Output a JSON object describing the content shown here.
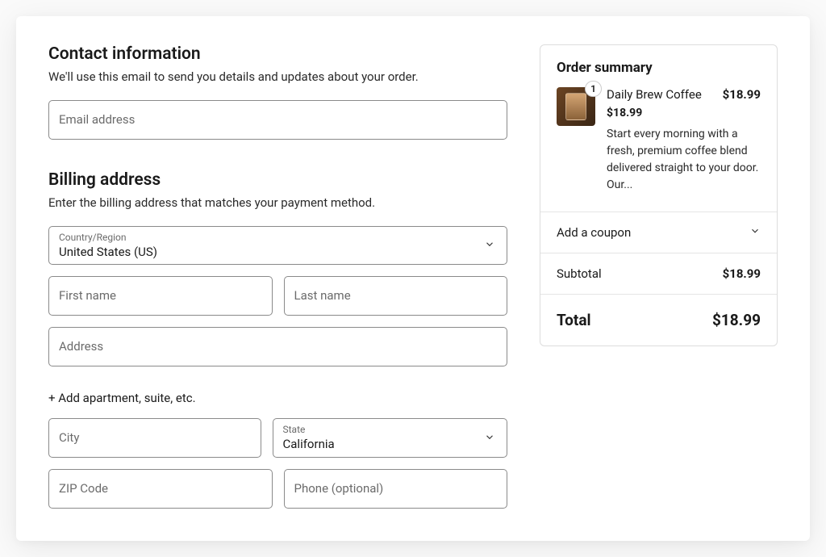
{
  "contact": {
    "title": "Contact information",
    "subtitle": "We'll use this email to send you details and updates about your order.",
    "email_label": "Email address",
    "email_value": ""
  },
  "billing": {
    "title": "Billing address",
    "subtitle": "Enter the billing address that matches your payment method.",
    "country_label": "Country/Region",
    "country_value": "United States (US)",
    "first_name_label": "First name",
    "first_name_value": "",
    "last_name_label": "Last name",
    "last_name_value": "",
    "address_label": "Address",
    "address_value": "",
    "add_apartment_label": "+ Add apartment, suite, etc.",
    "city_label": "City",
    "city_value": "",
    "state_label": "State",
    "state_value": "California",
    "zip_label": "ZIP Code",
    "zip_value": "",
    "phone_label": "Phone (optional)",
    "phone_value": ""
  },
  "summary": {
    "title": "Order summary",
    "item": {
      "quantity": "1",
      "name": "Daily Brew Coffee",
      "line_price": "$18.99",
      "unit_price": "$18.99",
      "description": "Start every morning with a fresh, premium coffee blend delivered straight to your door. Our..."
    },
    "coupon_label": "Add a coupon",
    "subtotal_label": "Subtotal",
    "subtotal_value": "$18.99",
    "total_label": "Total",
    "total_value": "$18.99"
  }
}
